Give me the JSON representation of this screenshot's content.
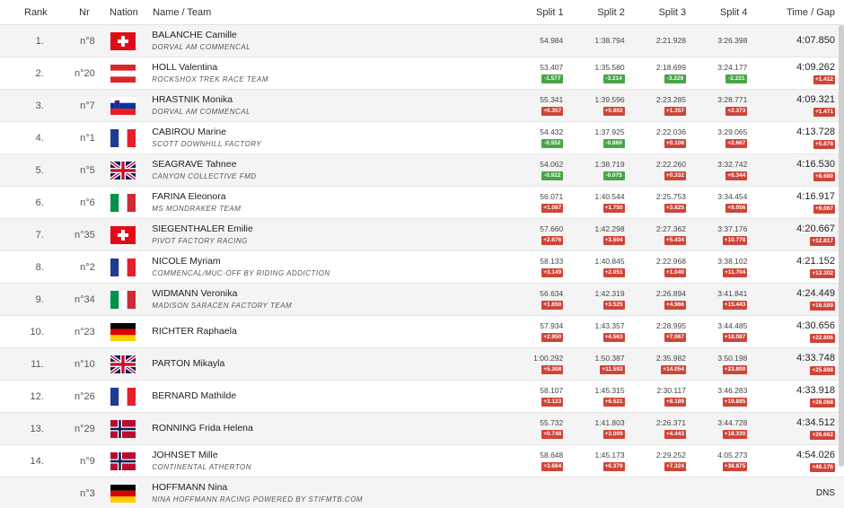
{
  "headers": {
    "rank": "Rank",
    "nr": "Nr",
    "nation": "Nation",
    "name": "Name / Team",
    "split1": "Split 1",
    "split2": "Split 2",
    "split3": "Split 3",
    "split4": "Split 4",
    "time": "Time / Gap"
  },
  "rows": [
    {
      "rank": "1.",
      "nr": "n°8",
      "flag": "SUI",
      "name": "BALANCHE Camille",
      "team": "DORVAL AM COMMENCAL",
      "s1": "54.984",
      "s1d": "",
      "s1c": "",
      "s2": "1:38.794",
      "s2d": "",
      "s2c": "",
      "s3": "2:21.928",
      "s3d": "",
      "s3c": "",
      "s4": "3:26.398",
      "s4d": "",
      "s4c": "",
      "time": "4:07.850",
      "gap": ""
    },
    {
      "rank": "2.",
      "nr": "n°20",
      "flag": "AUT",
      "name": "HOLL Valentina",
      "team": "ROCKSHOX TREK RACE TEAM",
      "s1": "53.407",
      "s1d": "-1.577",
      "s1c": "green",
      "s2": "1:35.580",
      "s2d": "-3.214",
      "s2c": "green",
      "s3": "2:18.699",
      "s3d": "-3.229",
      "s3c": "green",
      "s4": "3:24.177",
      "s4d": "-2.221",
      "s4c": "green",
      "time": "4:09.262",
      "gap": "+1.412"
    },
    {
      "rank": "3.",
      "nr": "n°7",
      "flag": "SLO",
      "name": "HRASTNIK Monika",
      "team": "DORVAL AM COMMENCAL",
      "s1": "55.341",
      "s1d": "+0.357",
      "s1c": "red",
      "s2": "1:39.596",
      "s2d": "+0.802",
      "s2c": "red",
      "s3": "2:23.285",
      "s3d": "+1.357",
      "s3c": "red",
      "s4": "3:28.771",
      "s4d": "+2.373",
      "s4c": "red",
      "time": "4:09.321",
      "gap": "+1.471"
    },
    {
      "rank": "4.",
      "nr": "n°1",
      "flag": "FRA",
      "name": "CABIROU Marine",
      "team": "SCOTT DOWNHILL FACTORY",
      "s1": "54.432",
      "s1d": "-0.552",
      "s1c": "green",
      "s2": "1:37.925",
      "s2d": "-0.869",
      "s2c": "green",
      "s3": "2:22.036",
      "s3d": "+0.108",
      "s3c": "red",
      "s4": "3:29.065",
      "s4d": "+2.667",
      "s4c": "red",
      "time": "4:13.728",
      "gap": "+5.878"
    },
    {
      "rank": "5.",
      "nr": "n°5",
      "flag": "GBR",
      "name": "SEAGRAVE Tahnee",
      "team": "CANYON COLLECTIVE FMD",
      "s1": "54.062",
      "s1d": "-0.922",
      "s1c": "green",
      "s2": "1:38.719",
      "s2d": "-0.075",
      "s2c": "green",
      "s3": "2:22.260",
      "s3d": "+0.332",
      "s3c": "red",
      "s4": "3:32.742",
      "s4d": "+6.344",
      "s4c": "red",
      "time": "4:16.530",
      "gap": "+8.680"
    },
    {
      "rank": "6.",
      "nr": "n°6",
      "flag": "ITA",
      "name": "FARINA Eleonora",
      "team": "MS MONDRAKER TEAM",
      "s1": "56.071",
      "s1d": "+1.087",
      "s1c": "red",
      "s2": "1:40.544",
      "s2d": "+1.750",
      "s2c": "red",
      "s3": "2:25.753",
      "s3d": "+3.825",
      "s3c": "red",
      "s4": "3:34.454",
      "s4d": "+8.056",
      "s4c": "red",
      "time": "4:16.917",
      "gap": "+9.067"
    },
    {
      "rank": "7.",
      "nr": "n°35",
      "flag": "SUI",
      "name": "SIEGENTHALER Emilie",
      "team": "PIVOT FACTORY RACING",
      "s1": "57.660",
      "s1d": "+2.676",
      "s1c": "red",
      "s2": "1:42.298",
      "s2d": "+3.504",
      "s2c": "red",
      "s3": "2:27.362",
      "s3d": "+5.434",
      "s3c": "red",
      "s4": "3:37.176",
      "s4d": "+10.778",
      "s4c": "red",
      "time": "4:20.667",
      "gap": "+12.817"
    },
    {
      "rank": "8.",
      "nr": "n°2",
      "flag": "FRA",
      "name": "NICOLE Myriam",
      "team": "COMMENCAL/MUC-OFF BY RIDING ADDICTION",
      "s1": "58.133",
      "s1d": "+3.149",
      "s1c": "red",
      "s2": "1:40.845",
      "s2d": "+2.051",
      "s2c": "red",
      "s3": "2:22.968",
      "s3d": "+1.040",
      "s3c": "red",
      "s4": "3:38.102",
      "s4d": "+11.704",
      "s4c": "red",
      "time": "4:21.152",
      "gap": "+13.302"
    },
    {
      "rank": "9.",
      "nr": "n°34",
      "flag": "ITA",
      "name": "WIDMANN Veronika",
      "team": "MADISON SARACEN FACTORY TEAM",
      "s1": "56.634",
      "s1d": "+1.650",
      "s1c": "red",
      "s2": "1:42.319",
      "s2d": "+3.525",
      "s2c": "red",
      "s3": "2:26.894",
      "s3d": "+4.966",
      "s3c": "red",
      "s4": "3:41.841",
      "s4d": "+15.443",
      "s4c": "red",
      "time": "4:24.449",
      "gap": "+16.599"
    },
    {
      "rank": "10.",
      "nr": "n°23",
      "flag": "GER",
      "name": "RICHTER Raphaela",
      "team": "",
      "s1": "57.934",
      "s1d": "+2.950",
      "s1c": "red",
      "s2": "1:43.357",
      "s2d": "+4.563",
      "s2c": "red",
      "s3": "2:28.995",
      "s3d": "+7.067",
      "s3c": "red",
      "s4": "3:44.485",
      "s4d": "+18.087",
      "s4c": "red",
      "time": "4:30.656",
      "gap": "+22.806"
    },
    {
      "rank": "11.",
      "nr": "n°10",
      "flag": "GBR",
      "name": "PARTON Mikayla",
      "team": "",
      "s1": "1:00.292",
      "s1d": "+5.308",
      "s1c": "red",
      "s2": "1:50.387",
      "s2d": "+11.593",
      "s2c": "red",
      "s3": "2:35.982",
      "s3d": "+14.054",
      "s3c": "red",
      "s4": "3:50.198",
      "s4d": "+23.800",
      "s4c": "red",
      "time": "4:33.748",
      "gap": "+25.898"
    },
    {
      "rank": "12.",
      "nr": "n°26",
      "flag": "FRA",
      "name": "BERNARD Mathilde",
      "team": "",
      "s1": "58.107",
      "s1d": "+3.123",
      "s1c": "red",
      "s2": "1:45.315",
      "s2d": "+6.521",
      "s2c": "red",
      "s3": "2:30.117",
      "s3d": "+8.189",
      "s3c": "red",
      "s4": "3:46.283",
      "s4d": "+19.885",
      "s4c": "red",
      "time": "4:33.918",
      "gap": "+26.068"
    },
    {
      "rank": "13.",
      "nr": "n°29",
      "flag": "NOR",
      "name": "RONNING Frida Helena",
      "team": "",
      "s1": "55.732",
      "s1d": "+0.748",
      "s1c": "red",
      "s2": "1:41.803",
      "s2d": "+3.009",
      "s2c": "red",
      "s3": "2:26.371",
      "s3d": "+4.443",
      "s3c": "red",
      "s4": "3:44.728",
      "s4d": "+18.330",
      "s4c": "red",
      "time": "4:34.512",
      "gap": "+26.662"
    },
    {
      "rank": "14.",
      "nr": "n°9",
      "flag": "NOR",
      "name": "JOHNSET Mille",
      "team": "CONTINENTAL ATHERTON",
      "s1": "58.648",
      "s1d": "+3.664",
      "s1c": "red",
      "s2": "1:45.173",
      "s2d": "+6.379",
      "s2c": "red",
      "s3": "2:29.252",
      "s3d": "+7.324",
      "s3c": "red",
      "s4": "4:05.273",
      "s4d": "+38.875",
      "s4c": "red",
      "time": "4:54.026",
      "gap": "+46.176"
    },
    {
      "rank": "",
      "nr": "n°3",
      "flag": "GER",
      "name": "HOFFMANN Nina",
      "team": "NINA HOFFMANN RACING POWERED BY STIFMTB.COM",
      "s1": "",
      "s1d": "",
      "s1c": "",
      "s2": "",
      "s2d": "",
      "s2c": "",
      "s3": "",
      "s3d": "",
      "s3c": "",
      "s4": "",
      "s4d": "",
      "s4c": "",
      "time": "DNS",
      "gap": ""
    }
  ],
  "flag_colors": {
    "swiss_red": "#e30a17",
    "austria_red": "#d8262c",
    "france_blue": "#1f3c93",
    "france_red": "#e4202c",
    "italy_green": "#009246",
    "italy_red": "#ce2b37",
    "germany_black": "#000000",
    "germany_red": "#dd0000",
    "germany_gold": "#ffce00",
    "norway_red": "#ba0c2f",
    "norway_blue": "#00205b",
    "uk_blue": "#012169",
    "uk_red": "#c8102e",
    "slovenia_blue": "#0033a0",
    "slovenia_red": "#ed1c24"
  }
}
